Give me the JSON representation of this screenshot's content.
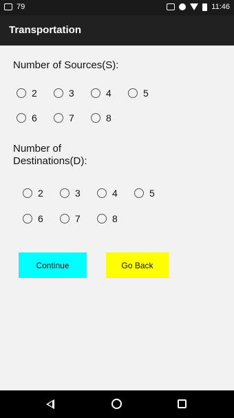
{
  "status_bar": {
    "notification_count": "79",
    "time": "11:46",
    "icons": [
      "photo-notification-icon",
      "cast-icon",
      "minus-circle-icon",
      "wifi-icon",
      "battery-icon"
    ]
  },
  "app_bar": {
    "title": "Transportation"
  },
  "sources": {
    "label": "Number of Sources(S):",
    "row1": [
      "2",
      "3",
      "4",
      "5"
    ],
    "row2": [
      "6",
      "7",
      "8"
    ]
  },
  "destinations": {
    "label_line1": "Number of",
    "label_line2": "Destinations(D):",
    "row1": [
      "2",
      "3",
      "4",
      "5"
    ],
    "row2": [
      "6",
      "7",
      "8"
    ]
  },
  "buttons": {
    "continue_label": "Continue",
    "continue_color": "#00ffff",
    "go_back_label": "Go Back",
    "go_back_color": "#ffff00"
  },
  "nav_bar": {
    "icons": [
      "back-icon",
      "home-icon",
      "recents-icon"
    ]
  }
}
